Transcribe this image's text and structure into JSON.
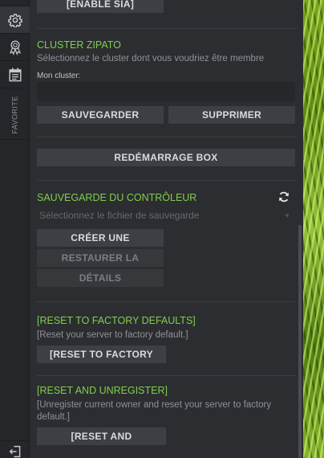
{
  "sidebar": {
    "favorite_label": "FAVORITE"
  },
  "sia": {
    "enable_label": "[ENABLE SIA]"
  },
  "cluster": {
    "title": "CLUSTER ZIPATO",
    "subtitle": "Sélectionnez le cluster dont vous voudriez être membre",
    "field_label": "Mon cluster:",
    "field_value": "",
    "save_label": "SAUVEGARDER",
    "delete_label": "SUPPRIMER"
  },
  "reboot": {
    "label": "REDÉMARRAGE BOX"
  },
  "backup": {
    "title": "SAUVEGARDE DU CONTRÔLEUR",
    "select_placeholder": "Sélectionnez le fichier de sauvegarde",
    "create_label": "CRÉER UNE",
    "restore_label": "RESTAURER LA",
    "details_label": "DÉTAILS"
  },
  "factory_reset": {
    "title": "[RESET TO FACTORY DEFAULTS]",
    "description": "[Reset your server to factory default.]",
    "button_label": "[RESET TO FACTORY"
  },
  "unregister": {
    "title": "[RESET AND UNREGISTER]",
    "description_line1": "[Unregister current owner and reset your server to factory",
    "description_line2": "default.]",
    "button_label": "[RESET AND"
  },
  "colors": {
    "accent_green": "#7fcf4a",
    "panel_bg": "#2c2d31",
    "button_bg": "#3d3f44"
  }
}
